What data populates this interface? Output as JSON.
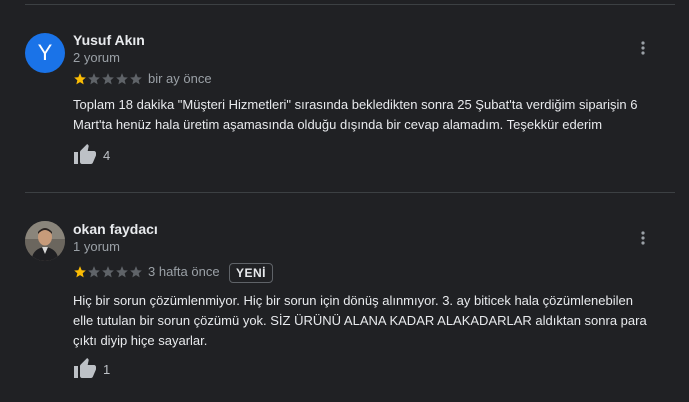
{
  "reviews": [
    {
      "avatar_letter": "Y",
      "avatar_color": "#1a73e8",
      "name": "Yusuf Akın",
      "review_count": "2 yorum",
      "rating": 1,
      "max_rating": 5,
      "date": "bir ay önce",
      "text": "Toplam 18 dakika \"Müşteri Hizmetleri\" sırasında bekledikten sonra 25 Şubat'ta verdiğim siparişin 6 Mart'ta henüz hala üretim aşamasında olduğu dışında bir cevap alamadım. Teşekkür ederim",
      "likes": "4",
      "more_icon": "more-vert-icon"
    },
    {
      "name": "okan faydacı",
      "review_count": "1 yorum",
      "rating": 1,
      "max_rating": 5,
      "date": "3 hafta önce",
      "badge": "YENİ",
      "text": "Hiç bir sorun çözümlenmiyor. Hiç bir sorun için dönüş alınmıyor. 3. ay biticek hala çözümlenebilen elle tutulan bir sorun çözümü yok. SİZ ÜRÜNÜ ALANA KADAR ALAKADARLAR  aldıktan sonra para çıktı diyip hiçe sayarlar.",
      "likes": "1",
      "more_icon": "more-vert-icon"
    }
  ],
  "colors": {
    "background": "#202124",
    "star_filled": "#fbbc04",
    "star_empty": "#5f6368",
    "text_primary": "#e8eaed",
    "text_secondary": "#9aa0a6"
  }
}
